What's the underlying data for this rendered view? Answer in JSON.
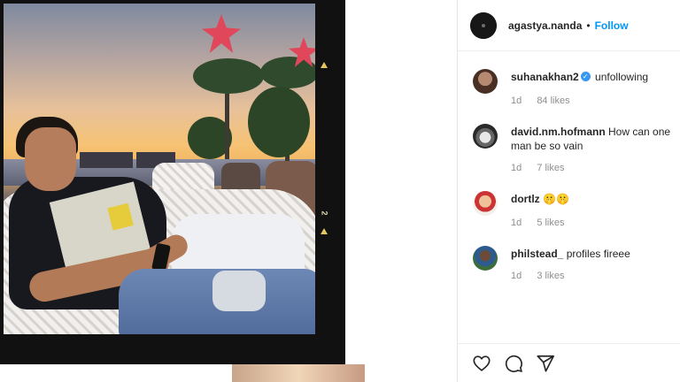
{
  "post": {
    "owner": {
      "username": "agastya.nanda",
      "follow_label": "Follow",
      "separator": "•"
    },
    "comments": [
      {
        "username": "suhanakhan2",
        "verified": true,
        "text": "unfollowing",
        "time": "1d",
        "likes": "84 likes"
      },
      {
        "username": "david.nm.hofmann",
        "verified": false,
        "text": "How can one man be so vain",
        "time": "1d",
        "likes": "7 likes"
      },
      {
        "username": "dortlz",
        "verified": false,
        "text": "🤫🤫",
        "time": "1d",
        "likes": "5 likes"
      },
      {
        "username": "philstead_",
        "verified": false,
        "text": "profiles fireee",
        "time": "1d",
        "likes": "3 likes"
      }
    ],
    "actions": [
      "heart-icon",
      "comment-icon",
      "share-icon"
    ]
  },
  "film_marks": {
    "mark_1": "2"
  },
  "colors": {
    "follow": "#0095f6",
    "verified": "#3897f0",
    "muted": "#8e8e8e",
    "text": "#262626"
  }
}
